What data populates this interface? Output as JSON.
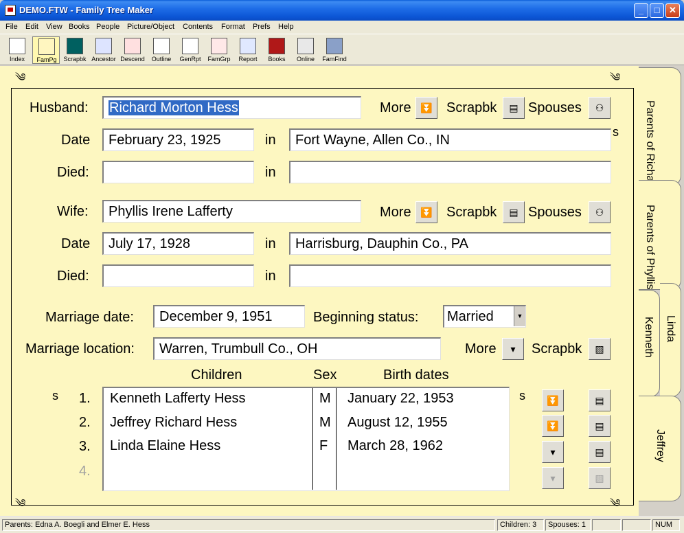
{
  "window": {
    "title": "DEMO.FTW - Family Tree Maker"
  },
  "menu": [
    "File",
    "Edit",
    "View",
    "Books",
    "People",
    "Picture/Object",
    "Contents",
    "Format",
    "Prefs",
    "Help"
  ],
  "toolbar": [
    "Index",
    "FamPg",
    "Scrapbk",
    "Ancestor",
    "Descend",
    "Outline",
    "GenRpt",
    "FamGrp",
    "Report",
    "Books",
    "Online",
    "FamFind"
  ],
  "husband": {
    "label": "Husband:",
    "name": "Richard Morton Hess",
    "date_label": "Date",
    "date": "February 23, 1925",
    "in_label": "in",
    "place": "Fort Wayne, Allen Co., IN",
    "died_label": "Died:",
    "died": "",
    "died_place": ""
  },
  "wife": {
    "label": "Wife:",
    "name": "Phyllis Irene Lafferty",
    "date_label": "Date",
    "date": "July 17, 1928",
    "in_label": "in",
    "place": "Harrisburg, Dauphin Co., PA",
    "died_label": "Died:",
    "died": "",
    "died_place": ""
  },
  "buttons": {
    "more": "More",
    "scrapbk": "Scrapbk",
    "spouses": "Spouses"
  },
  "marriage": {
    "date_label": "Marriage date:",
    "date": "December 9, 1951",
    "status_label": "Beginning status:",
    "status": "Married",
    "location_label": "Marriage location:",
    "location": "Warren, Trumbull Co., OH"
  },
  "children": {
    "header_name": "Children",
    "header_sex": "Sex",
    "header_birth": "Birth dates",
    "s_marker": "s",
    "rows": [
      {
        "num": "1.",
        "name": "Kenneth Lafferty Hess",
        "sex": "M",
        "birth": "January 22, 1953"
      },
      {
        "num": "2.",
        "name": "Jeffrey Richard Hess",
        "sex": "M",
        "birth": "August 12, 1955"
      },
      {
        "num": "3.",
        "name": "Linda Elaine Hess",
        "sex": "F",
        "birth": "March 28, 1962"
      },
      {
        "num": "4.",
        "name": "",
        "sex": "",
        "birth": ""
      }
    ]
  },
  "tabs": [
    "Parents of Richard",
    "Parents of Phyllis",
    "Kenneth",
    "Linda",
    "Jeffrey"
  ],
  "status": {
    "parents": "Parents: Edna A. Boegli and Elmer E. Hess",
    "children": "Children: 3",
    "spouses": "Spouses: 1",
    "num": "NUM"
  }
}
